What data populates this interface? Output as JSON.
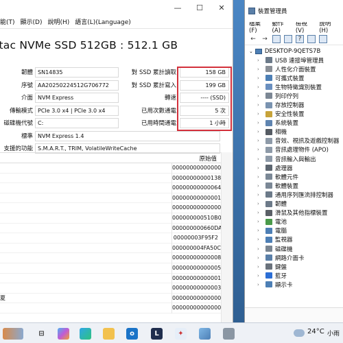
{
  "cdi": {
    "menu": [
      "能(T)",
      "顯示(D)",
      "說明(H)",
      "語言(L)(Language)"
    ],
    "disk_title": "itac NVMe SSD 512GB : 512.1 GB",
    "rows": [
      {
        "label": "韌體",
        "value": "SN14835",
        "label2": "對 SSD 累計讀取",
        "value2": "158 GB"
      },
      {
        "label": "序號",
        "value": "AA20250224512G706772",
        "label2": "對 SSD 累計寫入",
        "value2": "199 GB"
      },
      {
        "label": "介面",
        "value": "NVM Express",
        "label2": "轉速",
        "value2": "---- (SSD)"
      },
      {
        "label": "傳輸模式",
        "value": "PCIe 3.0 x4 | PCIe 3.0 x4",
        "label2": "已用次數通電",
        "value2": "5 次"
      },
      {
        "label": "磁碟機代號",
        "value": "C:",
        "label2": "已用時間通電",
        "value2": "1 小時"
      },
      {
        "label": "標準",
        "value": "NVM Express 1.4",
        "label2": "",
        "value2": ""
      },
      {
        "label": "支援的功能",
        "value": "S.M.A.R.T., TRIM, VolatileWriteCache",
        "label2": "",
        "value2": ""
      }
    ],
    "raw_header": "原始值",
    "raw_values": [
      "00000000000000",
      "00000000000138",
      "00000000000064",
      "00000000000001",
      "00000000000000",
      "000000000510B0",
      "000000000660DA",
      "00000003F95F2",
      "000000004FA50C",
      "00000000000008",
      "00000000000005",
      "00000000000001",
      "00000000000003",
      "00000000000000",
      "00000000000000"
    ],
    "row_name_fragments": [
      "",
      "",
      "",
      "",
      "",
      "",
      "",
      "",
      "",
      "",
      "",
      "",
      "",
      "夏",
      ""
    ]
  },
  "dm": {
    "title": "裝置管理員",
    "menu": [
      "檔案(F)",
      "動作(A)",
      "檢視(V)",
      "說明(H)"
    ],
    "root": "DESKTOP-9QETS7B",
    "items": [
      {
        "label": "USB 連接埠管理員",
        "color": "#6c7a89"
      },
      {
        "label": "人性化介面裝置",
        "color": "#8a8f96"
      },
      {
        "label": "可攜式裝置",
        "color": "#4d7fb5"
      },
      {
        "label": "生物特徵識別裝置",
        "color": "#6a8fbf"
      },
      {
        "label": "列印佇列",
        "color": "#7c8794"
      },
      {
        "label": "存放控制器",
        "color": "#7a93b0"
      },
      {
        "label": "安全性裝置",
        "color": "#c7a33a"
      },
      {
        "label": "系統裝置",
        "color": "#5f84b0"
      },
      {
        "label": "相機",
        "color": "#555b63"
      },
      {
        "label": "音效、視訊及遊戲控制器",
        "color": "#8e9aa8"
      },
      {
        "label": "音訊處理物件 (APO)",
        "color": "#8e9aa8"
      },
      {
        "label": "音訊輸入與輸出",
        "color": "#8e9aa8"
      },
      {
        "label": "處理器",
        "color": "#5d6670"
      },
      {
        "label": "軟體元件",
        "color": "#7b8896"
      },
      {
        "label": "軟體裝置",
        "color": "#7b8896"
      },
      {
        "label": "通用序列匯流排控制器",
        "color": "#6c7a89"
      },
      {
        "label": "韌體",
        "color": "#6c7a89"
      },
      {
        "label": "滑鼠及其他指標裝置",
        "color": "#5a5f66"
      },
      {
        "label": "電池",
        "color": "#4a9a4a"
      },
      {
        "label": "電腦",
        "color": "#4d7fb5"
      },
      {
        "label": "監視器",
        "color": "#4d7fb5"
      },
      {
        "label": "磁碟機",
        "color": "#7a8591"
      },
      {
        "label": "網路介面卡",
        "color": "#5a7fa8"
      },
      {
        "label": "鍵盤",
        "color": "#6a727c"
      },
      {
        "label": "藍牙",
        "color": "#2c6ed5"
      },
      {
        "label": "顯示卡",
        "color": "#4d7fb5"
      }
    ]
  },
  "taskbar": {
    "temp": "24°C",
    "condition": "小雨",
    "icons": [
      "widgets",
      "search",
      "task-view",
      "copilot",
      "edge",
      "file-explorer",
      "outlook",
      "line",
      "bird-app",
      "photos",
      "disk-app"
    ]
  }
}
